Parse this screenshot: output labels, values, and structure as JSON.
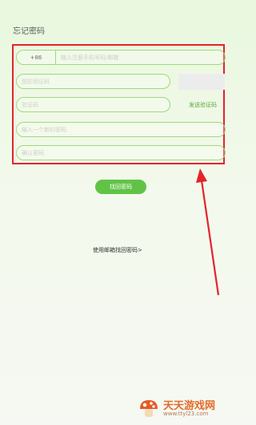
{
  "page": {
    "title": "忘记密码"
  },
  "form": {
    "country_code": "+86",
    "phone_placeholder": "输入注册手机号码/邮箱",
    "image_code_placeholder": "图形验证码",
    "sms_code_placeholder": "验证码",
    "send_code_label": "发送验证码",
    "new_password_placeholder": "输入一个新的密码",
    "confirm_password_placeholder": "确认密码",
    "submit_label": "找回密码"
  },
  "links": {
    "email_recover": "使用邮箱找回密码>"
  },
  "watermark": {
    "name": "天天游戏网",
    "url": "www.ttyl23.com"
  },
  "colors": {
    "accent": "#61c346",
    "annotation": "#e4232b",
    "field_border": "#9fd97b"
  },
  "icons": {
    "watermark_logo": "mushroom-logo-icon",
    "annotation_arrow": "arrow-up-left-icon"
  }
}
